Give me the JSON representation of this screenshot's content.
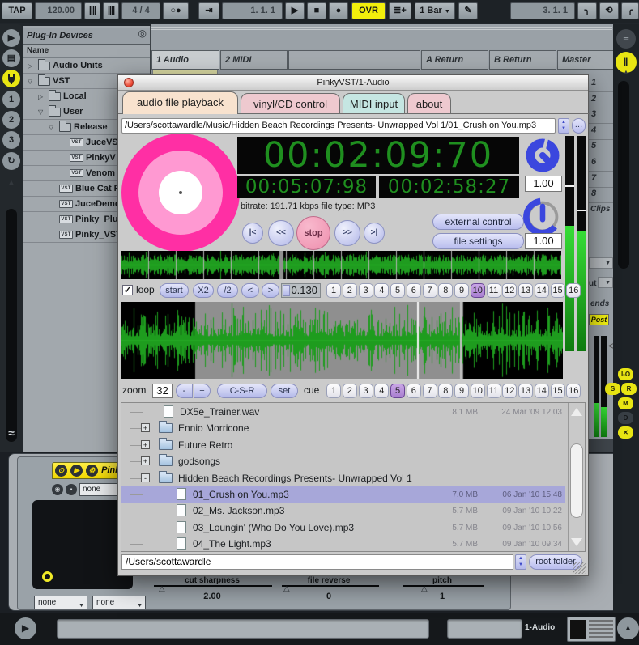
{
  "colors": {
    "lcd": "#1f8f1f",
    "vinyl": "#ff2fa4",
    "vring": "#ff99d2",
    "ovr": "#f2ef0c",
    "post": "#f0ee10",
    "tabA": "#f8e2ce",
    "tabP": "#eec9cf",
    "tabT": "#c5e6e2",
    "stop1": "#f8b9cd",
    "stop2": "#ee8fae",
    "rowsel": "#a7a7d9",
    "mhi": "#36dd36",
    "mlo": "#0f7a0f",
    "raily": "#e8e513",
    "knob": "#3b47de"
  },
  "toolbar": {
    "tap": "TAP",
    "tempo": "120.00",
    "time_sig": "4 / 4",
    "pos1": "1.  1.  1",
    "ovr": "OVR",
    "quantize": "1 Bar",
    "pos2": "3.  1.  1"
  },
  "icons": {
    "nudge": "||||",
    "metronome": "○●",
    "follow": "⇥",
    "play": "▶",
    "stop": "■",
    "record": "●",
    "draw": "≣+",
    "pencil": "✎",
    "fade_in": "╮",
    "loop_toggle": "⟲",
    "fade_out": "╭",
    "hamburger": "≡",
    "bars": "|||",
    "refresh": "↻",
    "wave": "≈",
    "browser_circle": "◎",
    "dropdown": "▼",
    "scroll_up": "▲",
    "scroll_down": "▼",
    "dots": "…",
    "check": "✓",
    "triangle": "△",
    "vst_badge": "VST",
    "eject": "▤",
    "n1": "1",
    "n2": "2",
    "n3": "3",
    "io": "I-O",
    "solo": "S",
    "ret": "R",
    "mix": "M",
    "dcap": "D",
    "xfade": "✕",
    "power": "⊙",
    "wrench": "⚙",
    "folder_open": "◉",
    "save": "▪"
  },
  "browser": {
    "title": "Plug-In Devices",
    "column": "Name",
    "items": [
      {
        "expander": "▷",
        "icon": "folder",
        "label": "Audio Units",
        "depth": 0
      },
      {
        "expander": "▽",
        "icon": "folder",
        "label": "VST",
        "depth": 0
      },
      {
        "expander": "▷",
        "icon": "folder",
        "label": "Local",
        "depth": 1
      },
      {
        "expander": "▽",
        "icon": "folder",
        "label": "User",
        "depth": 1
      },
      {
        "expander": "▽",
        "icon": "folder",
        "label": "Release",
        "depth": 2
      },
      {
        "expander": "",
        "icon": "vst",
        "label": "JuceVS",
        "depth": 3
      },
      {
        "expander": "",
        "icon": "vst",
        "label": "PinkyV",
        "depth": 3
      },
      {
        "expander": "",
        "icon": "vst",
        "label": "Venom",
        "depth": 3
      },
      {
        "expander": "",
        "icon": "vst",
        "label": "Blue Cat F",
        "depth": 2
      },
      {
        "expander": "",
        "icon": "vst",
        "label": "JuceDemo",
        "depth": 2
      },
      {
        "expander": "",
        "icon": "vst",
        "label": "Pinky_Plu",
        "depth": 2
      },
      {
        "expander": "",
        "icon": "vst",
        "label": "Pinky_VST",
        "depth": 2
      }
    ]
  },
  "session": {
    "tracks": [
      "1 Audio",
      "2 MIDI",
      "",
      "A Return",
      "B Return",
      "Master"
    ],
    "scenes": [
      "1",
      "2",
      "3",
      "4",
      "5",
      "6",
      "7",
      "8"
    ],
    "clips": "Clips",
    "out_fragment": "ut",
    "sends_fragment": "ends",
    "post": "Post"
  },
  "plugin": {
    "window_title": "PinkyVST/1-Audio",
    "tabs": [
      "audio file playback",
      "vinyl/CD control",
      "MIDI input",
      "about"
    ],
    "file_path": "/Users/scottawardle/Music/Hidden Beach Recordings Presents- Unwrapped Vol 1/01_Crush on You.mp3",
    "main_time": "00:02:09:70",
    "total_time": "00:05:07:98",
    "remain_time": "00:02:58:27",
    "file_info": "bitrate: 191.71 kbps  file type: MP3",
    "transport": [
      "|<",
      "<<",
      "stop",
      ">>",
      ">|"
    ],
    "external_control": "external control",
    "file_settings": "file settings",
    "knob1_value": "1.00",
    "knob2_value": "1.00",
    "loop": {
      "label": "loop",
      "checked": true,
      "buttons": [
        "start",
        "X2",
        "/2",
        "<",
        ">"
      ],
      "slider_value": "0.130",
      "active": "10"
    },
    "zoom": {
      "label": "zoom",
      "value": "32",
      "minus": "-",
      "plus": "+",
      "csr": "C-S-R",
      "set": "set",
      "cue_label": "cue",
      "active": "5"
    },
    "pad_numbers": [
      "1",
      "2",
      "3",
      "4",
      "5",
      "6",
      "7",
      "8",
      "9",
      "10",
      "11",
      "12",
      "13",
      "14",
      "15",
      "16"
    ],
    "file_browser": {
      "rows": [
        {
          "name": "DX5e_Trainer.wav",
          "type": "file",
          "indent": 52,
          "size": "8.1 MB",
          "date": "24 Mar '09 12:03"
        },
        {
          "name": "Ennio Morricone",
          "type": "folder",
          "expander": "+"
        },
        {
          "name": "Future Retro",
          "type": "folder",
          "expander": "+"
        },
        {
          "name": "godsongs",
          "type": "folder",
          "expander": "+"
        },
        {
          "name": "Hidden Beach Recordings Presents- Unwrapped Vol 1",
          "type": "folder",
          "expander": "-"
        },
        {
          "name": "01_Crush on You.mp3",
          "type": "file",
          "indent": 68,
          "size": "7.0 MB",
          "date": "06 Jan '10 15:48",
          "selected": true
        },
        {
          "name": "02_Ms. Jackson.mp3",
          "type": "file",
          "indent": 68,
          "size": "5.7 MB",
          "date": "09 Jan '10 10:22"
        },
        {
          "name": "03_Loungin' (Who Do You Love).mp3",
          "type": "file",
          "indent": 68,
          "size": "5.7 MB",
          "date": "09 Jan '10 10:56"
        },
        {
          "name": "04_The Light.mp3",
          "type": "file",
          "indent": 68,
          "size": "5.7 MB",
          "date": "09 Jan '10 09:34"
        }
      ],
      "root_path": "/Users/scottawardle",
      "root_button": "root folder"
    }
  },
  "device": {
    "title": "PinkyVST",
    "preset": "none",
    "dropdown1": "none",
    "dropdown2": "none",
    "params": [
      {
        "label": "cut sharpness",
        "value": "2.00"
      },
      {
        "label": "file reverse",
        "value": "0"
      },
      {
        "label": "pitch",
        "value": "1"
      }
    ]
  },
  "status_bar": {
    "track": "1-Audio"
  }
}
